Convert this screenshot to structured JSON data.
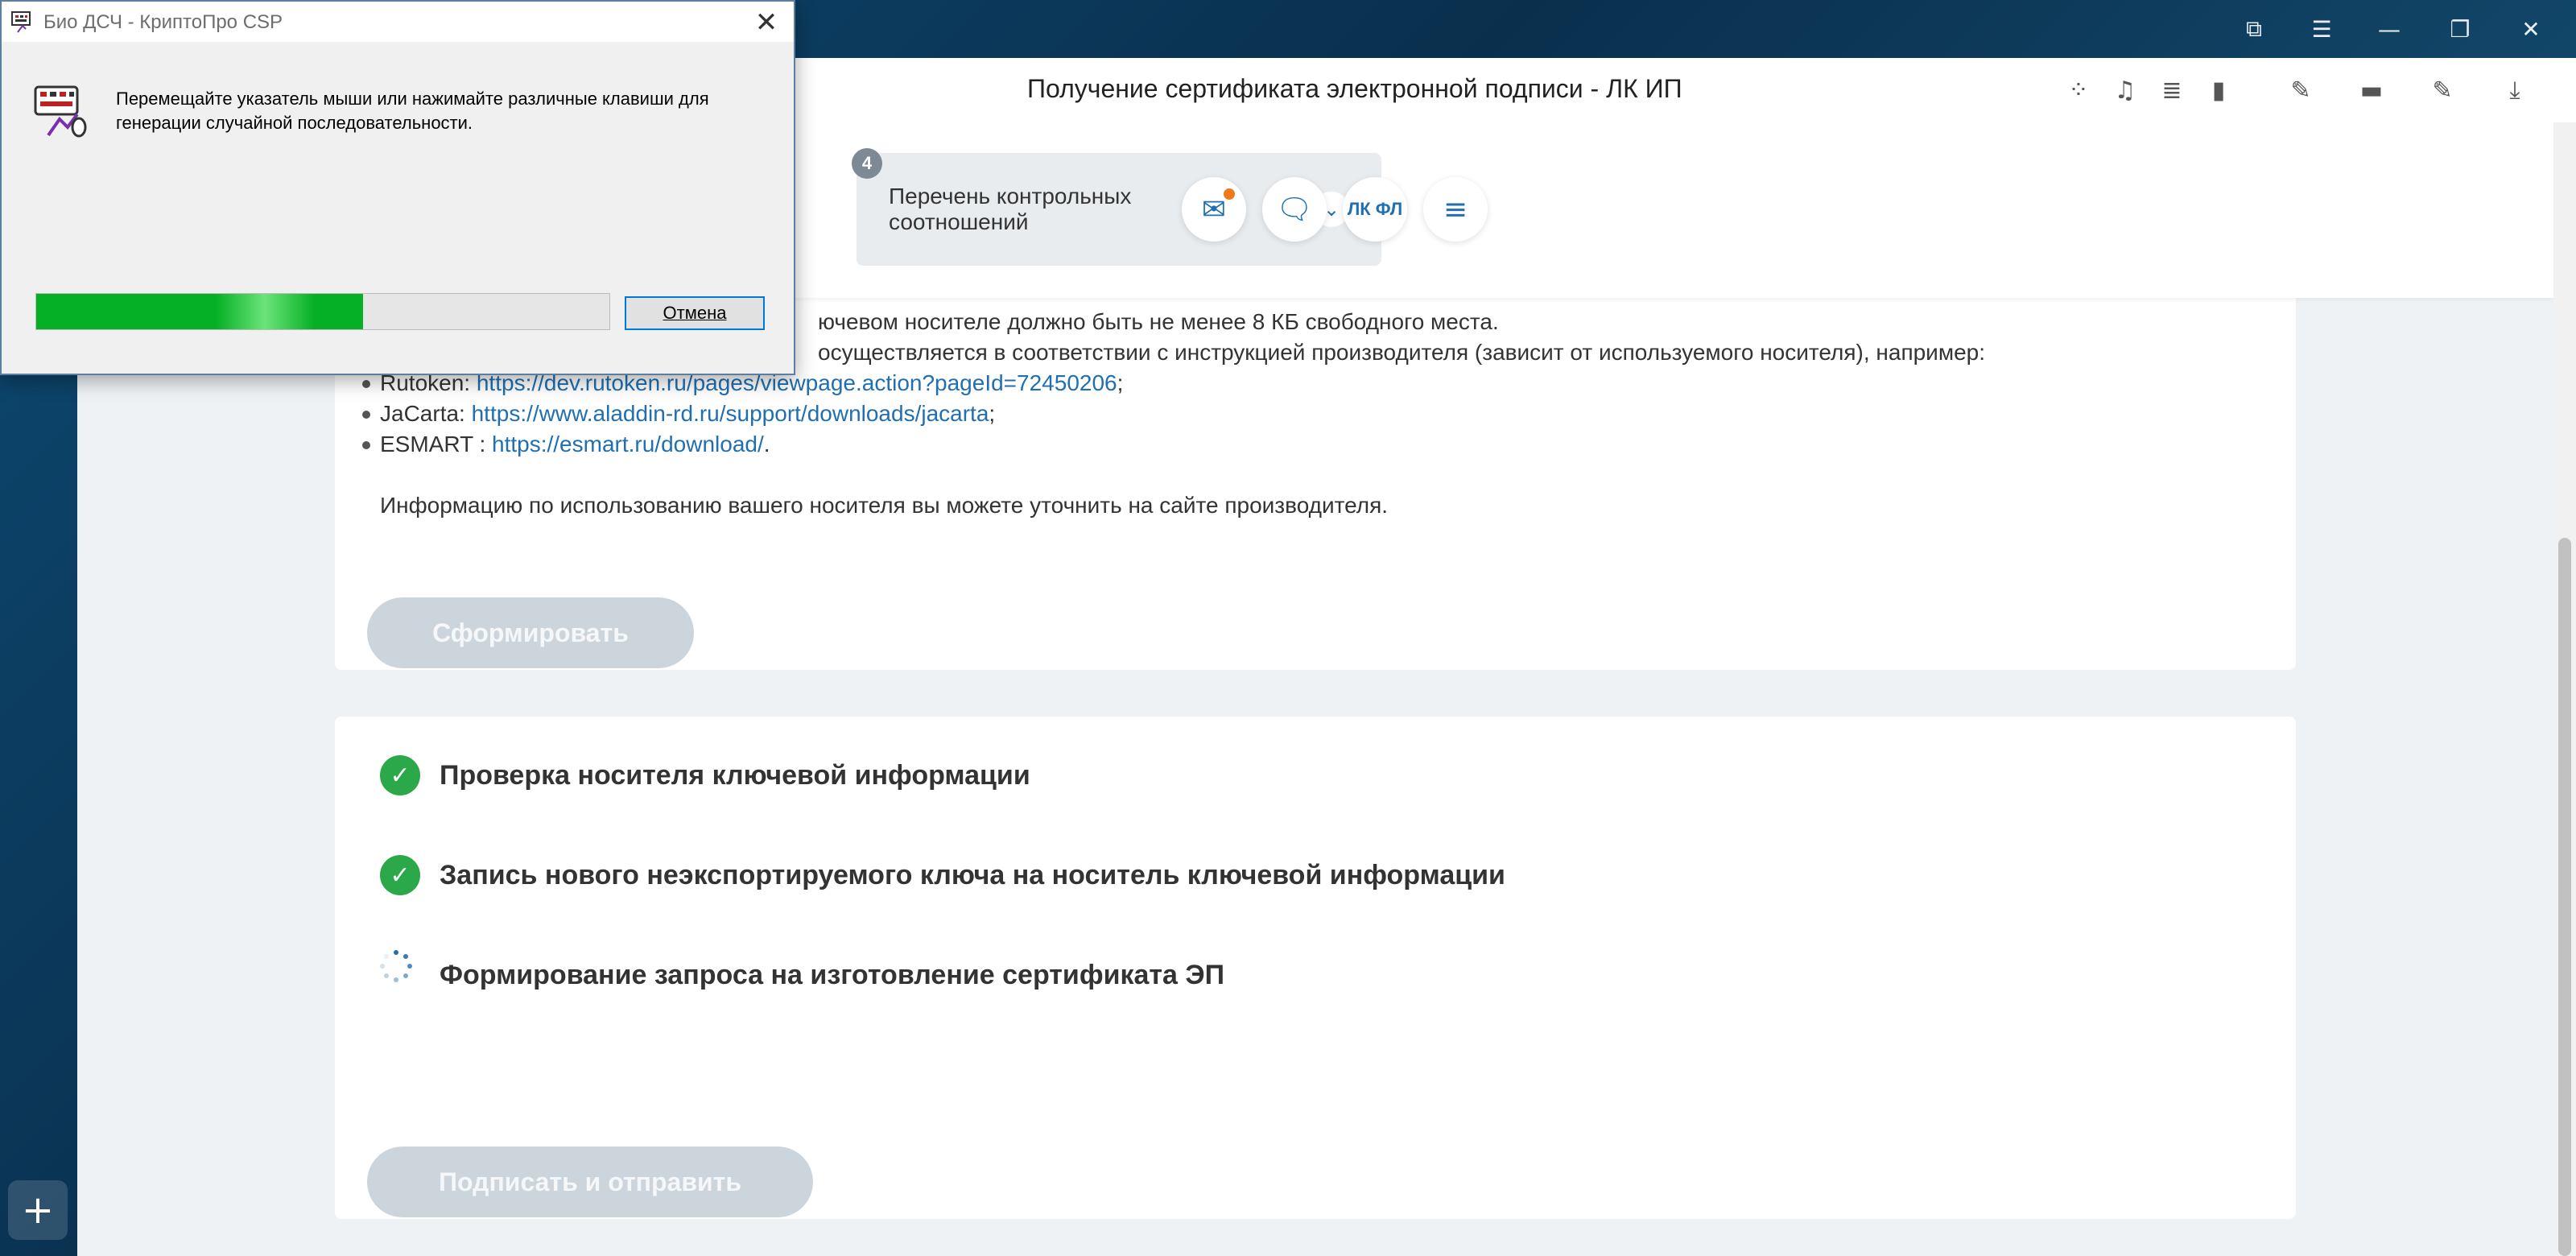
{
  "dialog": {
    "title": "Био ДСЧ - КриптоПро CSP",
    "message": "Перемещайте указатель мыши или нажимайте различные клавиши для генерации случайной последовательности.",
    "progress": 0.57,
    "cancel_label": "Отмена"
  },
  "browser": {
    "page_title": "Получение сертификата электронной подписи - ЛК ИП"
  },
  "header": {
    "step": {
      "number": "4",
      "label": "Перечень контрольных соотношений"
    },
    "lkfl_label": "ЛК ФЛ"
  },
  "info": {
    "line1": "ючевом носителе должно быть не менее 8 КБ свободного места.",
    "line2": "осуществляется в соответствии с инструкцией производителя (зависит от используемого носителя), например:",
    "rutoken_prefix": "Rutoken: ",
    "rutoken_link": "https://dev.rutoken.ru/pages/viewpage.action?pageId=72450206",
    "rutoken_suffix": ";",
    "jacarta_prefix": "JaCarta: ",
    "jacarta_link": "https://www.aladdin-rd.ru/support/downloads/jacarta",
    "jacarta_suffix": ";",
    "esmart_prefix": "ESMART : ",
    "esmart_link": "https://esmart.ru/download/",
    "esmart_suffix": ".",
    "footer": "Информацию по использованию вашего носителя вы можете уточнить на сайте производителя."
  },
  "buttons": {
    "generate": "Сформировать",
    "sign_send": "Подписать и отправить"
  },
  "stages": [
    {
      "label": "Проверка носителя ключевой информации",
      "status": "done"
    },
    {
      "label": "Запись нового неэкспортируемого ключа на носитель ключевой информации",
      "status": "done"
    },
    {
      "label": "Формирование запроса на изготовление сертификата ЭП",
      "status": "in-progress"
    }
  ],
  "colors": {
    "accent": "#1f6fb2",
    "success": "#2aa84a",
    "progress_green": "#06b025",
    "notification": "#f07a1a"
  }
}
